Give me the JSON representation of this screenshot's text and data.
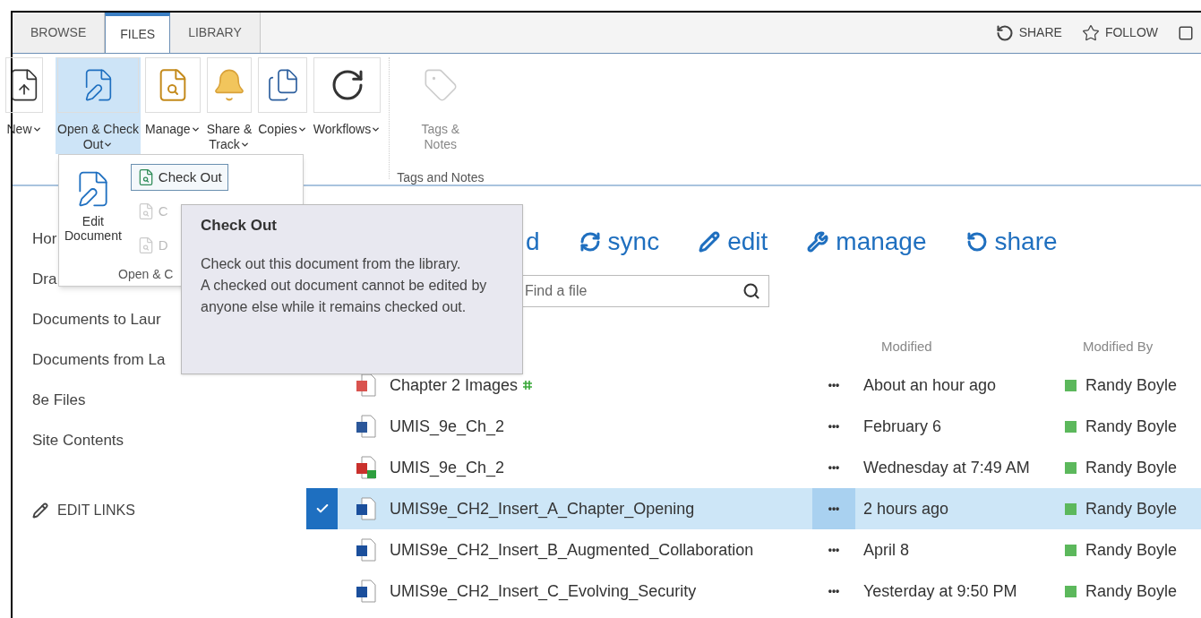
{
  "tabs": [
    {
      "label": "BROWSE",
      "selected": false
    },
    {
      "label": "FILES",
      "selected": true
    },
    {
      "label": "LIBRARY",
      "selected": false
    }
  ],
  "top_actions": [
    {
      "label": "SHARE",
      "kind": "share"
    },
    {
      "label": "FOLLOW",
      "kind": "follow"
    }
  ],
  "ribbon": {
    "buttons": [
      {
        "lines": [
          "New"
        ],
        "kind": "new",
        "dropdown": true,
        "selected": false,
        "disabled": false
      },
      {
        "lines": [
          "Open & Check",
          "Out"
        ],
        "kind": "edit",
        "dropdown": true,
        "selected": true,
        "disabled": false
      },
      {
        "lines": [
          "Manage"
        ],
        "kind": "manage",
        "dropdown": true,
        "selected": false,
        "disabled": false
      },
      {
        "lines": [
          "Share &",
          "Track"
        ],
        "kind": "bell",
        "dropdown": true,
        "selected": false,
        "disabled": false
      },
      {
        "lines": [
          "Copies"
        ],
        "kind": "copies",
        "dropdown": true,
        "selected": false,
        "disabled": false
      },
      {
        "lines": [
          "Workflows"
        ],
        "kind": "workflow",
        "dropdown": true,
        "selected": false,
        "disabled": false
      },
      {
        "lines": [
          "Tags &",
          "Notes"
        ],
        "kind": "tag",
        "dropdown": false,
        "selected": false,
        "disabled": true
      }
    ],
    "group_label": "Tags and Notes"
  },
  "dropdown": {
    "large": [
      "Edit",
      "Document"
    ],
    "items": [
      {
        "label": "Check Out",
        "highlighted": true,
        "disabled": false
      },
      {
        "label": "C",
        "highlighted": false,
        "disabled": true
      },
      {
        "label": "D",
        "highlighted": false,
        "disabled": true
      }
    ],
    "group_label": "Open & C"
  },
  "tooltip": {
    "title": "Check Out",
    "lines": [
      "Check out this document from the library.",
      "A checked out document cannot be edited by anyone else while it remains checked out."
    ]
  },
  "nav": [
    {
      "label": "Hor"
    },
    {
      "label": "Dra"
    },
    {
      "label": "Documents to Laur"
    },
    {
      "label": "Documents from La"
    },
    {
      "label": "8e Files"
    },
    {
      "label": "Site Contents"
    }
  ],
  "edit_links": "EDIT LINKS",
  "commands": [
    {
      "label": "d",
      "kind": "none"
    },
    {
      "label": "sync",
      "kind": "sync"
    },
    {
      "label": "edit",
      "kind": "edit"
    },
    {
      "label": "manage",
      "kind": "manage"
    },
    {
      "label": "share",
      "kind": "share"
    }
  ],
  "search": {
    "placeholder": "Find a file"
  },
  "columns": [
    "Modified",
    "Modified By"
  ],
  "more_label": "•••",
  "rows": [
    {
      "name": "Chapter 2 Images",
      "kind": "image",
      "new": true,
      "selected": false,
      "modified": "About an hour ago",
      "modified_by": "Randy Boyle"
    },
    {
      "name": "UMIS_9e_Ch_2",
      "kind": "word",
      "new": false,
      "selected": false,
      "modified": "February 6",
      "modified_by": "Randy Boyle"
    },
    {
      "name": "UMIS_9e_Ch_2",
      "kind": "pdf",
      "new": false,
      "selected": false,
      "modified": "Wednesday at 7:49 AM",
      "modified_by": "Randy Boyle"
    },
    {
      "name": "UMIS9e_CH2_Insert_A_Chapter_Opening",
      "kind": "doc",
      "new": false,
      "selected": true,
      "modified": "2 hours ago",
      "modified_by": "Randy Boyle"
    },
    {
      "name": "UMIS9e_CH2_Insert_B_Augmented_Collaboration",
      "kind": "doc",
      "new": false,
      "selected": false,
      "modified": "April 8",
      "modified_by": "Randy Boyle"
    },
    {
      "name": "UMIS9e_CH2_Insert_C_Evolving_Security",
      "kind": "doc",
      "new": false,
      "selected": false,
      "modified": "Yesterday at 9:50 PM",
      "modified_by": "Randy Boyle"
    }
  ]
}
